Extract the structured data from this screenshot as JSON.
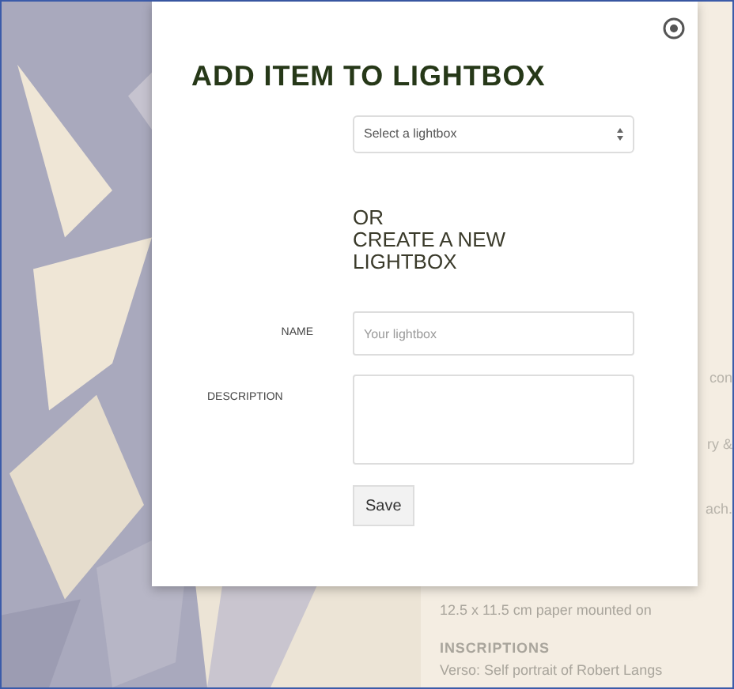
{
  "background": {
    "fragments": [
      "con",
      "ry &",
      "ach."
    ],
    "details": [
      {
        "kind": "value",
        "text": "12.5 x 11.5 cm paper mounted on"
      },
      {
        "kind": "heading",
        "text": "INSCRIPTIONS"
      },
      {
        "kind": "value",
        "text": "Verso: Self portrait of Robert Langs"
      }
    ]
  },
  "dialog": {
    "title": "ADD ITEM TO LIGHTBOX",
    "select": {
      "value": "Select a lightbox"
    },
    "create_heading": [
      "OR",
      "CREATE A NEW",
      "LIGHTBOX"
    ],
    "name": {
      "label": "NAME",
      "placeholder": "Your lightbox"
    },
    "description": {
      "label": "DESCRIPTION"
    },
    "save_button": "Save"
  }
}
